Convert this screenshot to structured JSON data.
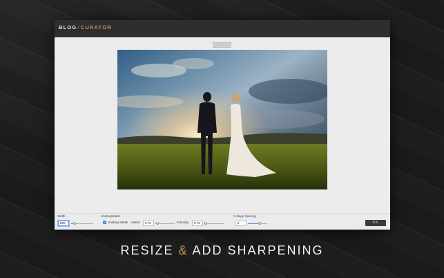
{
  "app": {
    "logo_part1": "BLOG",
    "logo_slash": "/",
    "logo_part2": "CURATOR"
  },
  "pager": {
    "prev": "‹",
    "next": "›"
  },
  "controls": {
    "width": {
      "label": "Width",
      "value": "800",
      "slider_fraction": 0.15
    },
    "unsharp": {
      "group_label": "UnsharpMask",
      "checkbox_label": "Unsharp Mask",
      "checked": true,
      "radius_label": "radius:",
      "radius_value": "0.75",
      "radius_fraction": 0.1,
      "intensity_label": "Intensity:",
      "intensity_value": "0.79",
      "intensity_fraction": 0.1
    },
    "collage": {
      "label": "Collage Spacing",
      "value": "8",
      "slider_fraction": 0.6
    },
    "ok_label": "OK"
  },
  "headline": {
    "part1": "RESIZE",
    "amp": "&",
    "part2": "ADD SHARPENING"
  },
  "colors": {
    "accent_gold": "#b8955a",
    "slider_blue": "#4a86d8",
    "titlebar": "#2e2e2e",
    "window_bg": "#ececec"
  }
}
